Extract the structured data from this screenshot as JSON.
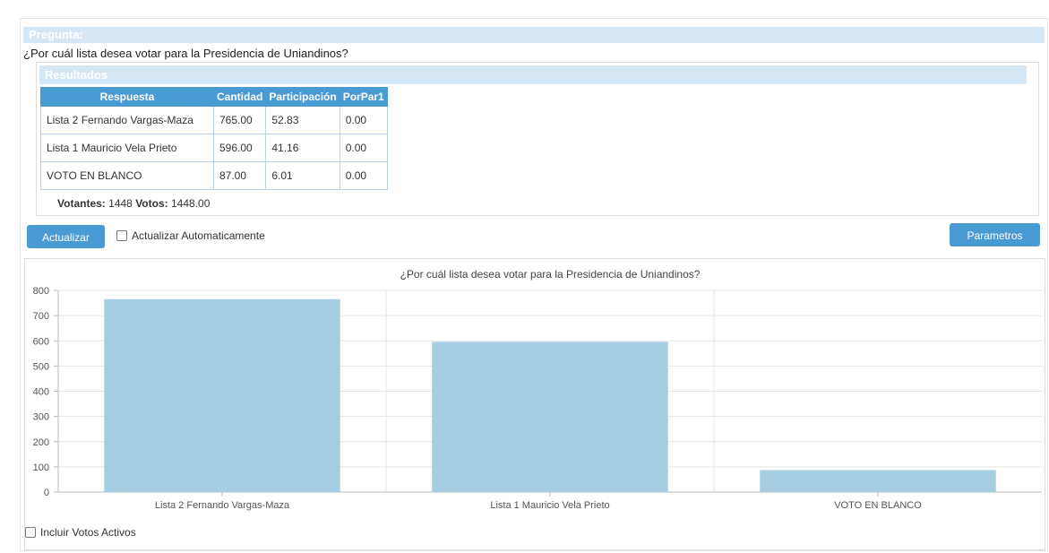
{
  "pregunta": {
    "header": "Pregunta:",
    "text": "¿Por cuál lista desea votar para la Presidencia de Uniandinos?"
  },
  "resultados": {
    "header": "Resultados",
    "columns": [
      "Respuesta",
      "Cantidad",
      "Participación",
      "PorPar1"
    ],
    "rows": [
      [
        "Lista 2 Fernando Vargas-Maza",
        "765.00",
        "52.83",
        "0.00"
      ],
      [
        "Lista 1 Mauricio Vela Prieto",
        "596.00",
        "41.16",
        "0.00"
      ],
      [
        "VOTO EN BLANCO",
        "87.00",
        "6.01",
        "0.00"
      ]
    ],
    "votantes_label": "Votantes:",
    "votantes_value": "1448",
    "votos_label": "Votos:",
    "votos_value": "1448.00"
  },
  "controls": {
    "actualizar_label": "Actualizar",
    "auto_update_label": "Actualizar Automaticamente",
    "parametros_label": "Parametros",
    "incluir_votos_label": "Incluir Votos Activos"
  },
  "colors": {
    "accent": "#4a9ad4",
    "header_bg": "#d5e6f4",
    "bar": "#a7cde3"
  },
  "chart_data": {
    "type": "bar",
    "title": "¿Por cuál lista desea votar para la Presidencia de Uniandinos?",
    "categories": [
      "Lista 2 Fernando Vargas-Maza",
      "Lista 1 Mauricio Vela Prieto",
      "VOTO EN BLANCO"
    ],
    "values": [
      765,
      596,
      87
    ],
    "ylim": [
      0,
      800
    ],
    "yticks": [
      0,
      100,
      200,
      300,
      400,
      500,
      600,
      700,
      800
    ],
    "grid": true,
    "xlabel": "",
    "ylabel": ""
  }
}
